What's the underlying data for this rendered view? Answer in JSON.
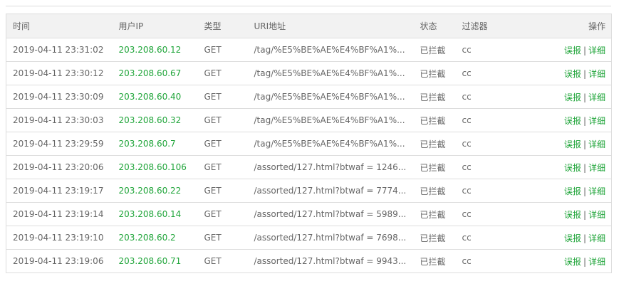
{
  "columns": {
    "time": "时间",
    "ip": "用户IP",
    "type": "类型",
    "uri": "URI地址",
    "status": "状态",
    "filter": "过滤器",
    "actions": "操作"
  },
  "rows": [
    {
      "time": "2019-04-11 23:31:02",
      "ip": "203.208.60.12",
      "type": "GET",
      "uri": "/tag/%E5%BE%AE%E4%BF%A1%...",
      "status": "已拦截",
      "filter": "cc",
      "report": "误报",
      "sep": "|",
      "detail": "详细"
    },
    {
      "time": "2019-04-11 23:30:12",
      "ip": "203.208.60.67",
      "type": "GET",
      "uri": "/tag/%E5%BE%AE%E4%BF%A1%...",
      "status": "已拦截",
      "filter": "cc",
      "report": "误报",
      "sep": "|",
      "detail": "详细"
    },
    {
      "time": "2019-04-11 23:30:09",
      "ip": "203.208.60.40",
      "type": "GET",
      "uri": "/tag/%E5%BE%AE%E4%BF%A1%...",
      "status": "已拦截",
      "filter": "cc",
      "report": "误报",
      "sep": "|",
      "detail": "详细"
    },
    {
      "time": "2019-04-11 23:30:03",
      "ip": "203.208.60.32",
      "type": "GET",
      "uri": "/tag/%E5%BE%AE%E4%BF%A1%...",
      "status": "已拦截",
      "filter": "cc",
      "report": "误报",
      "sep": "|",
      "detail": "详细"
    },
    {
      "time": "2019-04-11 23:29:59",
      "ip": "203.208.60.7",
      "type": "GET",
      "uri": "/tag/%E5%BE%AE%E4%BF%A1%...",
      "status": "已拦截",
      "filter": "cc",
      "report": "误报",
      "sep": "|",
      "detail": "详细"
    },
    {
      "time": "2019-04-11 23:20:06",
      "ip": "203.208.60.106",
      "type": "GET",
      "uri": "/assorted/127.html?btwaf = 1246...",
      "status": "已拦截",
      "filter": "cc",
      "report": "误报",
      "sep": "|",
      "detail": "详细"
    },
    {
      "time": "2019-04-11 23:19:17",
      "ip": "203.208.60.22",
      "type": "GET",
      "uri": "/assorted/127.html?btwaf = 7774...",
      "status": "已拦截",
      "filter": "cc",
      "report": "误报",
      "sep": "|",
      "detail": "详细"
    },
    {
      "time": "2019-04-11 23:19:14",
      "ip": "203.208.60.14",
      "type": "GET",
      "uri": "/assorted/127.html?btwaf = 5989...",
      "status": "已拦截",
      "filter": "cc",
      "report": "误报",
      "sep": "|",
      "detail": "详细"
    },
    {
      "time": "2019-04-11 23:19:10",
      "ip": "203.208.60.2",
      "type": "GET",
      "uri": "/assorted/127.html?btwaf = 7698...",
      "status": "已拦截",
      "filter": "cc",
      "report": "误报",
      "sep": "|",
      "detail": "详细"
    },
    {
      "time": "2019-04-11 23:19:06",
      "ip": "203.208.60.71",
      "type": "GET",
      "uri": "/assorted/127.html?btwaf = 9943...",
      "status": "已拦截",
      "filter": "cc",
      "report": "误报",
      "sep": "|",
      "detail": "详细"
    }
  ],
  "colors": {
    "link_green": "#20a53a",
    "header_bg": "#f2f2f2",
    "border": "#dddddd",
    "text": "#666666"
  }
}
